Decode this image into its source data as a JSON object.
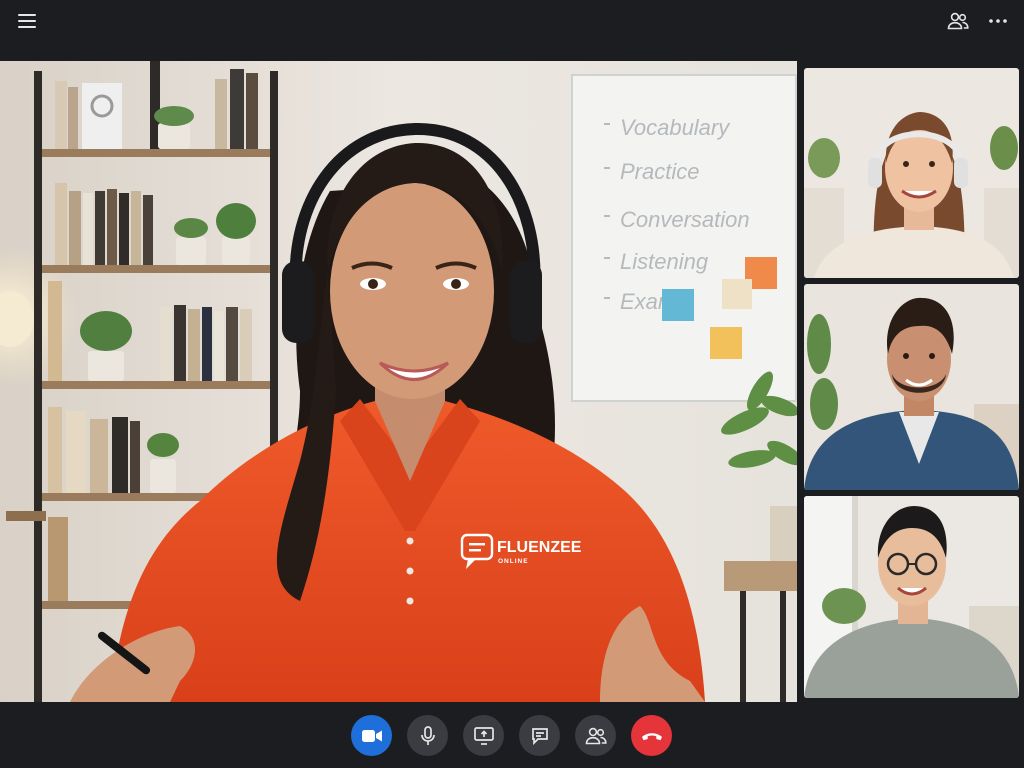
{
  "topbar": {
    "menu_icon": "hamburger-menu-icon",
    "participants_icon": "people-icon",
    "more_icon": "more-horizontal-icon"
  },
  "main_video": {
    "whiteboard_lines": [
      "Vocabulary",
      "Practice",
      "Conversation",
      "Listening",
      "Exam"
    ],
    "shirt_logo": {
      "name": "FLUENZEE",
      "sub": "ONLINE"
    }
  },
  "controls": [
    {
      "name": "camera-button",
      "icon": "video-camera-icon",
      "state": "on",
      "color": "#1e6fd9"
    },
    {
      "name": "microphone-button",
      "icon": "microphone-icon",
      "color": "#3a3c42"
    },
    {
      "name": "share-screen-button",
      "icon": "screen-share-icon",
      "color": "#3a3c42"
    },
    {
      "name": "chat-button",
      "icon": "chat-bubble-icon",
      "color": "#3a3c42"
    },
    {
      "name": "participants-button",
      "icon": "people-icon",
      "color": "#3a3c42"
    },
    {
      "name": "end-call-button",
      "icon": "phone-hangup-icon",
      "color": "#e5343a"
    }
  ],
  "colors": {
    "background": "#1b1d21",
    "accent": "#1e6fd9",
    "danger": "#e5343a",
    "shirt": "#e8481c"
  }
}
